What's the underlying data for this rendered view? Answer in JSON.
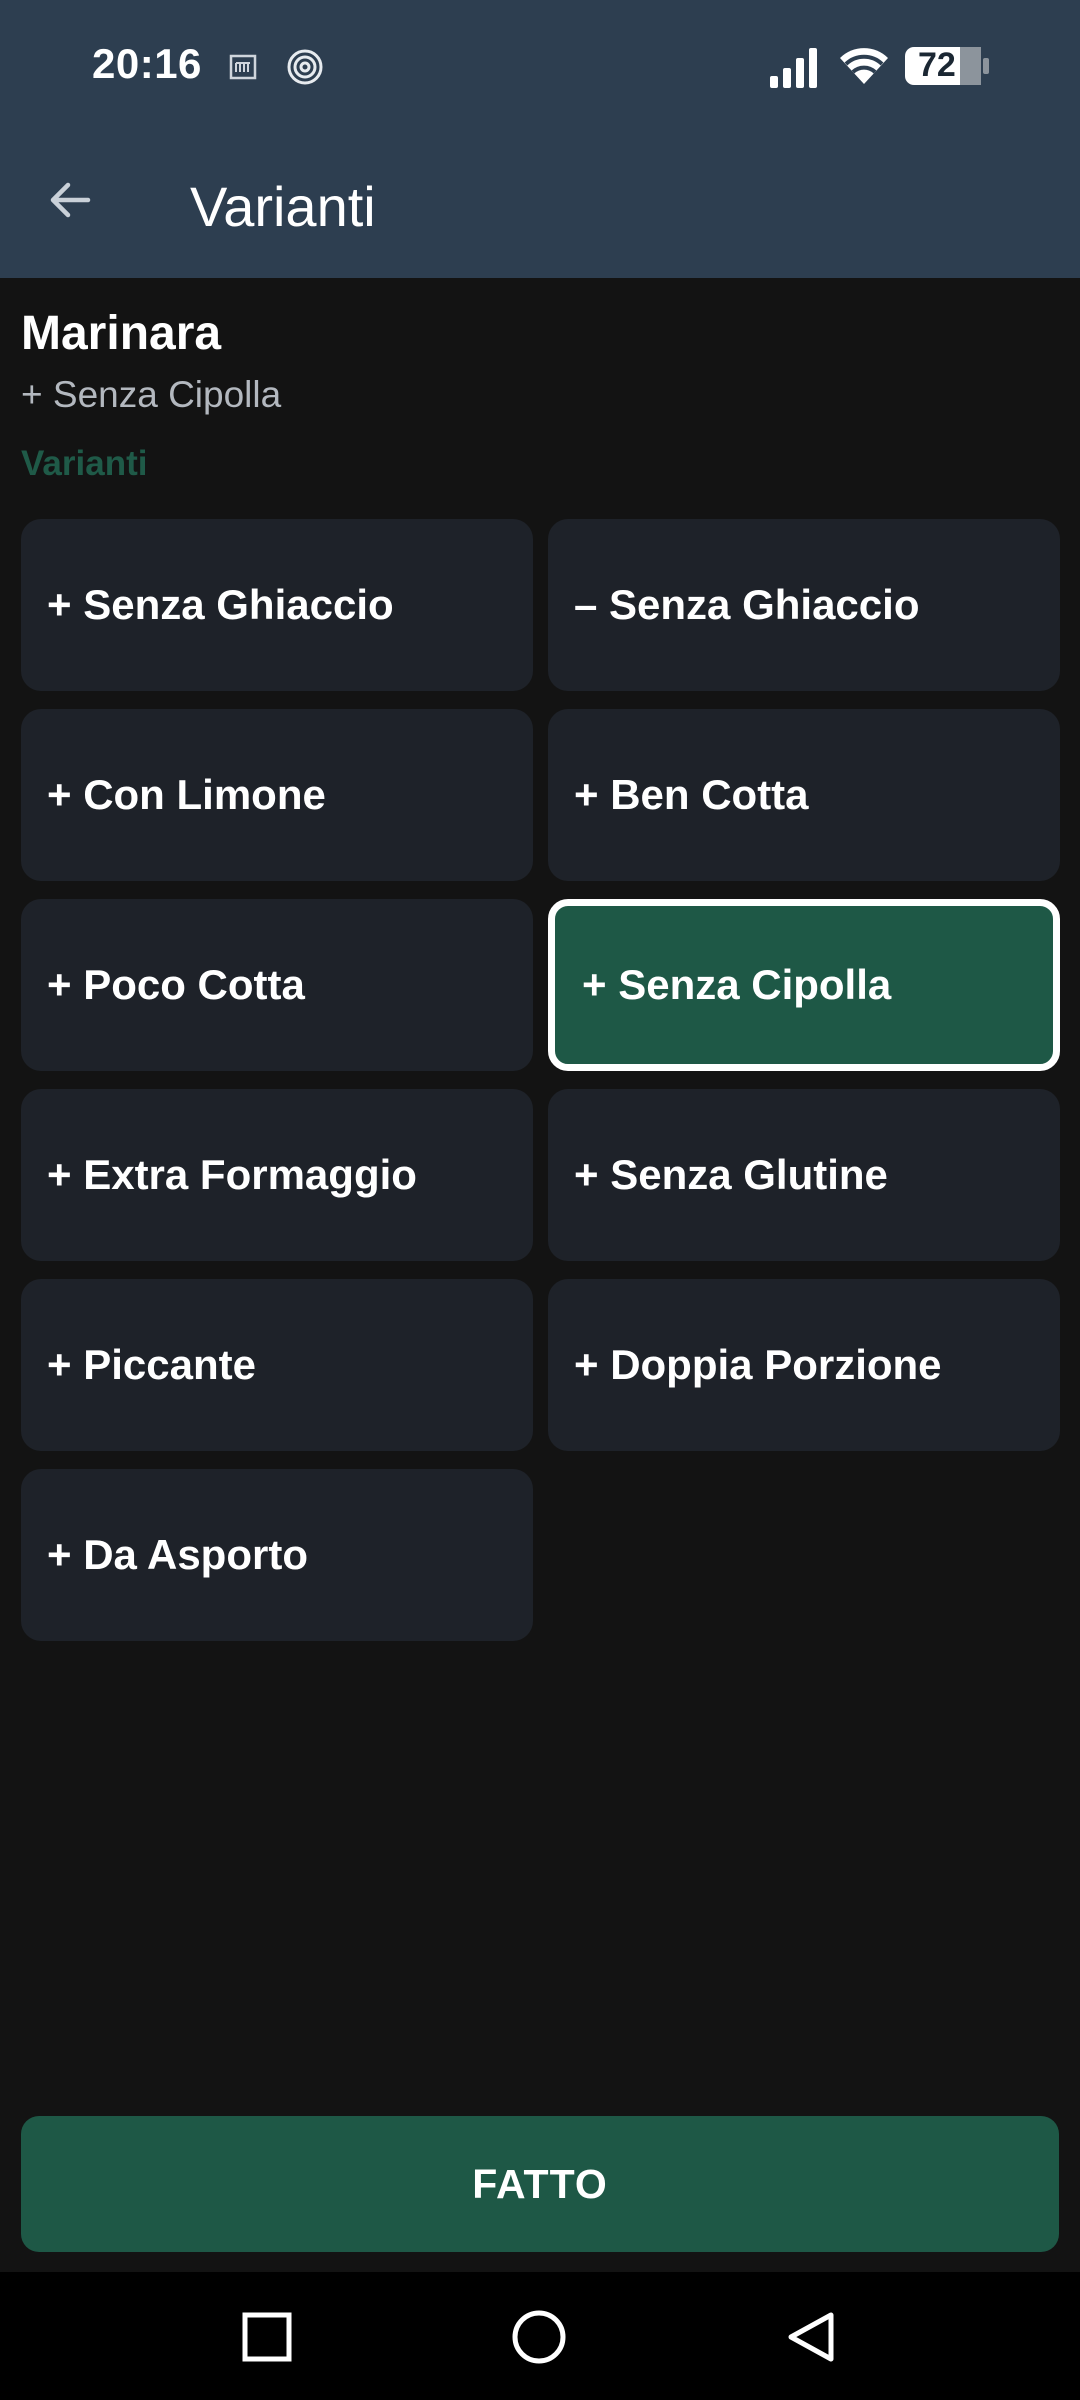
{
  "status_bar": {
    "time": "20:16",
    "battery": "72",
    "icons": [
      "sim-card-icon",
      "spiral-icon",
      "signal-icon",
      "wifi-icon",
      "battery-icon"
    ]
  },
  "app_bar": {
    "title": "Varianti",
    "back_icon": "arrow-left-icon"
  },
  "item": {
    "name": "Marinara",
    "selected_summary": "+ Senza Cipolla"
  },
  "section_label": "Varianti",
  "variants": [
    {
      "label": "+ Senza Ghiaccio",
      "selected": false
    },
    {
      "label": "– Senza Ghiaccio",
      "selected": false
    },
    {
      "label": "+ Con Limone",
      "selected": false
    },
    {
      "label": "+ Ben Cotta",
      "selected": false
    },
    {
      "label": "+ Poco Cotta",
      "selected": false
    },
    {
      "label": "+ Senza Cipolla",
      "selected": true
    },
    {
      "label": "+ Extra Formaggio",
      "selected": false
    },
    {
      "label": "+ Senza Glutine",
      "selected": false
    },
    {
      "label": "+ Piccante",
      "selected": false
    },
    {
      "label": "+ Doppia Porzione",
      "selected": false
    },
    {
      "label": "+ Da Asporto",
      "selected": false
    }
  ],
  "done_button": "FATTO",
  "colors": {
    "header_bg": "#2d3e50",
    "background": "#131313",
    "chip_bg": "#1e2229",
    "accent_green": "#1e5846",
    "section_label": "#1f5a48"
  },
  "nav_bar": {
    "icons": [
      "recents-square-icon",
      "home-circle-icon",
      "back-triangle-icon"
    ]
  }
}
